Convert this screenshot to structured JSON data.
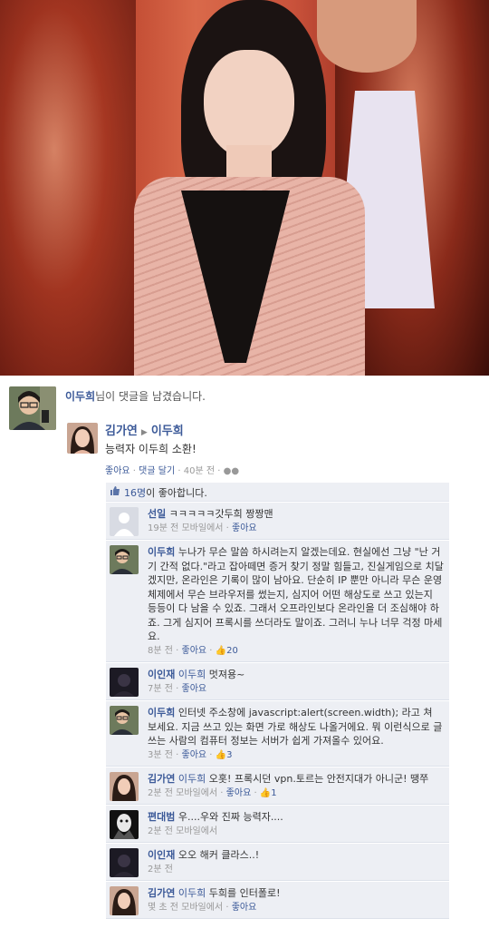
{
  "notification": {
    "actor": "이두희",
    "text": "님이 댓글을 남겼습니다."
  },
  "post": {
    "author": "김가연",
    "arrow": "▶",
    "target": "이두희",
    "message": "능력자 이두희 소환!",
    "like_label": "좋아요",
    "comment_label": "댓글 달기",
    "time": "40분 전",
    "sep": "·"
  },
  "likes": {
    "count_text": "16명",
    "suffix": "이 좋아합니다."
  },
  "comments": [
    {
      "author": "선일",
      "tag": "",
      "text": "ㅋㅋㅋㅋㅋ갓두희 짱짱맨",
      "time": "19분 전 모바일에서",
      "like": "좋아요",
      "likes": "",
      "avatar": "grey-icon"
    },
    {
      "author": "이두희",
      "tag": "",
      "text": "누나가 무슨 말씀 하시려는지 알겠는데요. 현실에선 그냥 \"난 거기 간적 없다.\"라고 잡아떼면 증거 찾기 정말 힘들고, 진실게임으로 치달겠지만, 온라인은 기록이 많이 남아요. 단순히 IP 뿐만 아니라 무슨 운영체제에서 무슨 브라우저를 썼는지, 심지어 어떤 해상도로 쓰고 있는지 등등이 다 남을 수 있죠. 그래서 오프라인보다 온라인을 더 조심해야 하죠. 그게 심지어 프록시를 쓰더라도 말이죠. 그러니 누나 너무 걱정 마세요.",
      "time": "8분 전",
      "like": "좋아요",
      "likes": "20",
      "avatar": "glasses-man"
    },
    {
      "author": "이인재",
      "tag": "이두희",
      "text": "멋져용~",
      "time": "7분 전",
      "like": "좋아요",
      "likes": "",
      "avatar": "dark-photo"
    },
    {
      "author": "이두희",
      "tag": "",
      "text": "인터넷 주소창에 javascript:alert(screen.width); 라고 쳐 보세요. 지금 쓰고 있는 화면 가로 해상도 나올거에요. 뭐 이런식으로 글쓰는 사람의 컴퓨터 정보는 서버가 쉽게 가져올수 있어요.",
      "time": "3분 전",
      "like": "좋아요",
      "likes": "3",
      "avatar": "glasses-man"
    },
    {
      "author": "김가연",
      "tag": "이두희",
      "text": "오홋! 프록시던 vpn.토르는 안전지대가 아니군! 땡쭈",
      "time": "2분 전 모바일에서",
      "like": "좋아요",
      "likes": "1",
      "avatar": "woman"
    },
    {
      "author": "편대범",
      "tag": "",
      "text": "우....우와 진짜 능력자....",
      "time": "2분 전 모바일에서",
      "like": "",
      "likes": "",
      "avatar": "bw-art"
    },
    {
      "author": "이인재",
      "tag": "",
      "text": "오오 해커 클라스..!",
      "time": "2분 전",
      "like": "",
      "likes": "",
      "avatar": "dark-photo"
    },
    {
      "author": "김가연",
      "tag": "이두희",
      "text": "두희를 인터폴로!",
      "time": "몇 초 전 모바일에서",
      "like": "좋아요",
      "likes": "",
      "avatar": "woman"
    }
  ]
}
